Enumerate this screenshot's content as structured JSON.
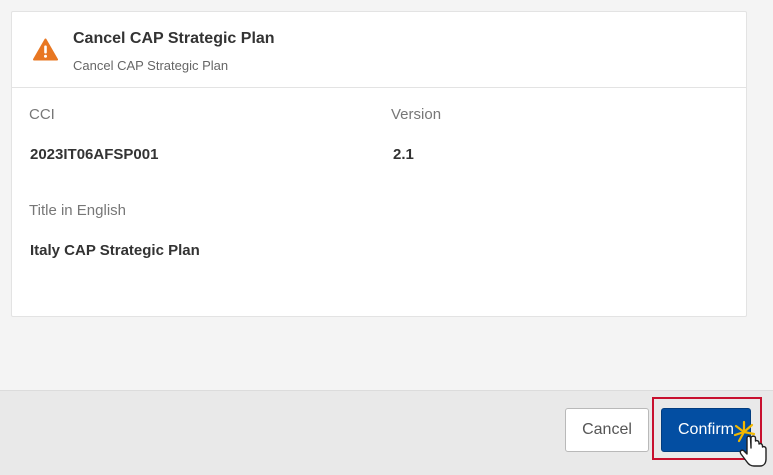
{
  "dialog": {
    "title": "Cancel CAP Strategic Plan",
    "subtitle": "Cancel CAP Strategic Plan",
    "icon": "warning-icon",
    "accent_color": "#e87722"
  },
  "fields": {
    "cci_label": "CCI",
    "cci_value": "2023IT06AFSP001",
    "version_label": "Version",
    "version_value": "2.1",
    "title_label": "Title in English",
    "title_value": "Italy CAP Strategic Plan"
  },
  "footer": {
    "cancel_label": "Cancel",
    "confirm_label": "Confirm",
    "primary_color": "#034ea2",
    "highlight_color": "#c8102e"
  },
  "cursor": {
    "icon": "hand-pointer-click-icon"
  }
}
